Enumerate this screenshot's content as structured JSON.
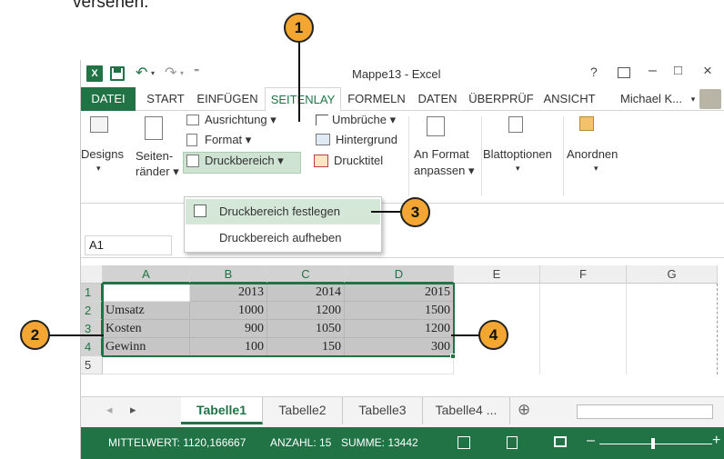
{
  "doc_text": "versehen.",
  "window": {
    "title": "Mappe13 - Excel",
    "help": "?",
    "minimize": "–",
    "maximize": "□",
    "close": "×",
    "undo_glyph": "↶",
    "redo_glyph": "↷",
    "qat_more": "⁼"
  },
  "tabs": [
    {
      "label": "DATEI"
    },
    {
      "label": "START"
    },
    {
      "label": "EINFÜGEN"
    },
    {
      "label": "SEITENLAY"
    },
    {
      "label": "FORMELN"
    },
    {
      "label": "DATEN"
    },
    {
      "label": "ÜBERPRÜF"
    },
    {
      "label": "ANSICHT"
    }
  ],
  "user": "Michael K...",
  "ribbon": {
    "designs": "Designs",
    "seitenraender_1": "Seiten-",
    "seitenraender_2": "ränder ▾",
    "ausrichtung": "Ausrichtung ▾",
    "format": "Format ▾",
    "druckbereich": "Druckbereich ▾",
    "umbrueche": "Umbrüche ▾",
    "hintergrund": "Hintergrund",
    "drucktitel": "Drucktitel",
    "anformat_1": "An Format",
    "anformat_2": "anpassen ▾",
    "blattoptionen": "Blattoptionen",
    "anordnen": "Anordnen",
    "arrow": "▾"
  },
  "dropdown": {
    "item1": "Druckbereich festlegen",
    "item2": "Druckbereich aufheben"
  },
  "namebox": "A1",
  "columns": [
    "A",
    "B",
    "C",
    "D",
    "E",
    "F",
    "G"
  ],
  "rows": [
    "1",
    "2",
    "3",
    "4",
    "5"
  ],
  "table": {
    "years": [
      "2013",
      "2014",
      "2015"
    ],
    "rows": [
      {
        "label": "Umsatz",
        "values": [
          "1000",
          "1200",
          "1500"
        ]
      },
      {
        "label": "Kosten",
        "values": [
          "900",
          "1050",
          "1200"
        ]
      },
      {
        "label": "Gewinn",
        "values": [
          "100",
          "150",
          "300"
        ]
      }
    ]
  },
  "sheets": [
    "Tabelle1",
    "Tabelle2",
    "Tabelle3",
    "Tabelle4 ..."
  ],
  "sheet_nav": {
    "prev": "◂",
    "next": "▸",
    "add": "⊕"
  },
  "status": {
    "mittelwert": "MITTELWERT: 1120,166667",
    "anzahl": "ANZAHL: 15",
    "summe": "SUMME: 13442",
    "zoom_minus": "–",
    "zoom_plus": "+"
  },
  "callouts": [
    "1",
    "2",
    "3",
    "4"
  ],
  "colors": {
    "accent": "#217346",
    "callout": "#f3a632"
  }
}
